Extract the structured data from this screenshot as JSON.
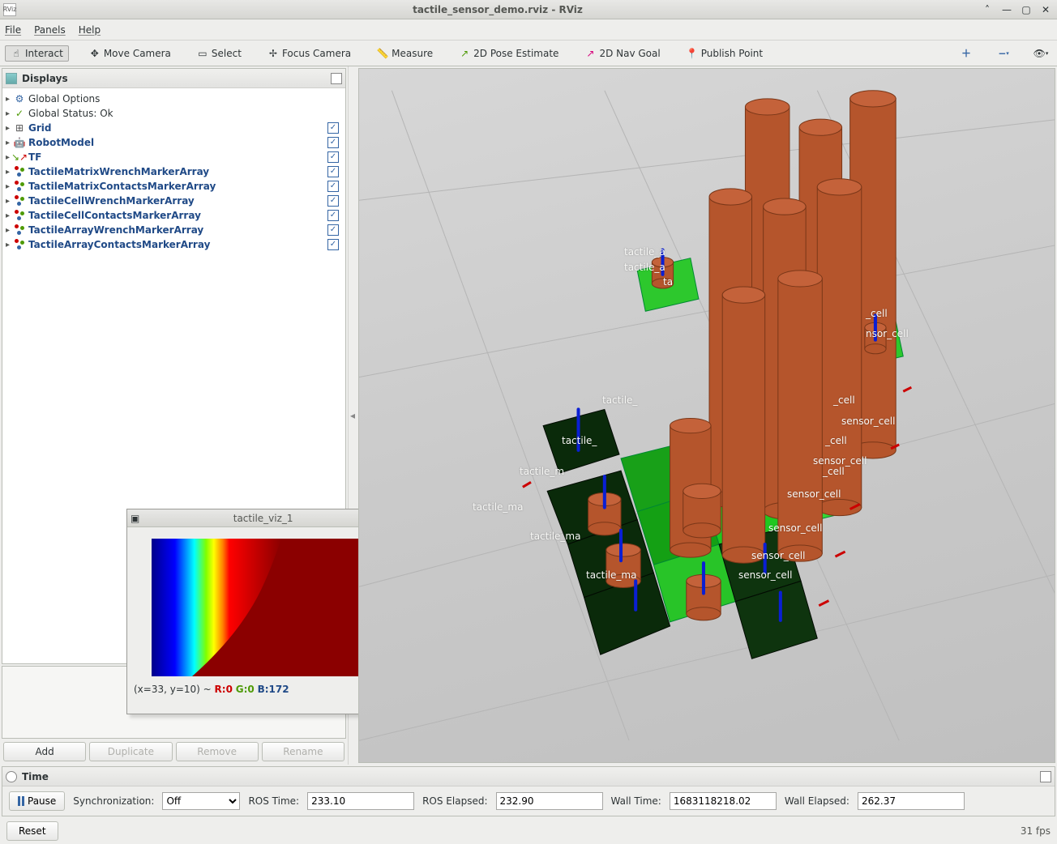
{
  "window": {
    "title": "tactile_sensor_demo.rviz - RViz",
    "app_abbr": "RViz"
  },
  "menubar": {
    "file": "File",
    "panels": "Panels",
    "help": "Help"
  },
  "toolbar": {
    "interact": "Interact",
    "move_camera": "Move Camera",
    "select": "Select",
    "focus_camera": "Focus Camera",
    "measure": "Measure",
    "pose_estimate": "2D Pose Estimate",
    "nav_goal": "2D Nav Goal",
    "publish_point": "Publish Point"
  },
  "displays": {
    "title": "Displays",
    "items": [
      {
        "label": "Global Options",
        "blue": false,
        "check": null,
        "icon": "gear-icon"
      },
      {
        "label": "Global Status: Ok",
        "blue": false,
        "check": null,
        "icon": "check-icon"
      },
      {
        "label": "Grid",
        "blue": true,
        "check": true,
        "icon": "grid-icon"
      },
      {
        "label": "RobotModel",
        "blue": true,
        "check": true,
        "icon": "robot-icon"
      },
      {
        "label": "TF",
        "blue": true,
        "check": true,
        "icon": "tf-icon"
      },
      {
        "label": "TactileMatrixWrenchMarkerArray",
        "blue": true,
        "check": true,
        "icon": "marker-array-icon"
      },
      {
        "label": "TactileMatrixContactsMarkerArray",
        "blue": true,
        "check": true,
        "icon": "marker-array-icon"
      },
      {
        "label": "TactileCellWrenchMarkerArray",
        "blue": true,
        "check": true,
        "icon": "marker-array-icon"
      },
      {
        "label": "TactileCellContactsMarkerArray",
        "blue": true,
        "check": true,
        "icon": "marker-array-icon"
      },
      {
        "label": "TactileArrayWrenchMarkerArray",
        "blue": true,
        "check": true,
        "icon": "marker-array-icon"
      },
      {
        "label": "TactileArrayContactsMarkerArray",
        "blue": true,
        "check": true,
        "icon": "marker-array-icon"
      }
    ],
    "buttons": {
      "add": "Add",
      "duplicate": "Duplicate",
      "remove": "Remove",
      "rename": "Rename"
    }
  },
  "time": {
    "title": "Time",
    "pause": "Pause",
    "sync_label": "Synchronization:",
    "sync_value": "Off",
    "ros_time_label": "ROS Time:",
    "ros_time": "233.10",
    "ros_elapsed_label": "ROS Elapsed:",
    "ros_elapsed": "232.90",
    "wall_time_label": "Wall Time:",
    "wall_time": "1683118218.02",
    "wall_elapsed_label": "Wall Elapsed:",
    "wall_elapsed": "262.37"
  },
  "footer": {
    "reset": "Reset",
    "fps": "31 fps"
  },
  "float": {
    "title": "tactile_viz_1",
    "status_prefix": "(x=33, y=10) ~ ",
    "r_label": "R:0",
    "g_label": "G:0",
    "b_label": "B:172"
  },
  "scene_labels": {
    "l0": "tactile_a",
    "l1": "tactile_a",
    "l2": "ta",
    "l3": "nsor_cell",
    "l4": "_cell",
    "l5": "tactile_",
    "l6": "_cell",
    "l7": "sensor_cell",
    "l8": "tactile_",
    "l9": "_cell",
    "l10": "sensor_cell",
    "l11": "tactile_m",
    "l12": "_cell",
    "l13": "sensor_cell",
    "l14": "tactile_ma",
    "l15": "sensor_cell",
    "l16": "tactile_ma",
    "l17": "sensor_cell",
    "l18": "tactile_ma",
    "l19": "sensor_cell"
  }
}
